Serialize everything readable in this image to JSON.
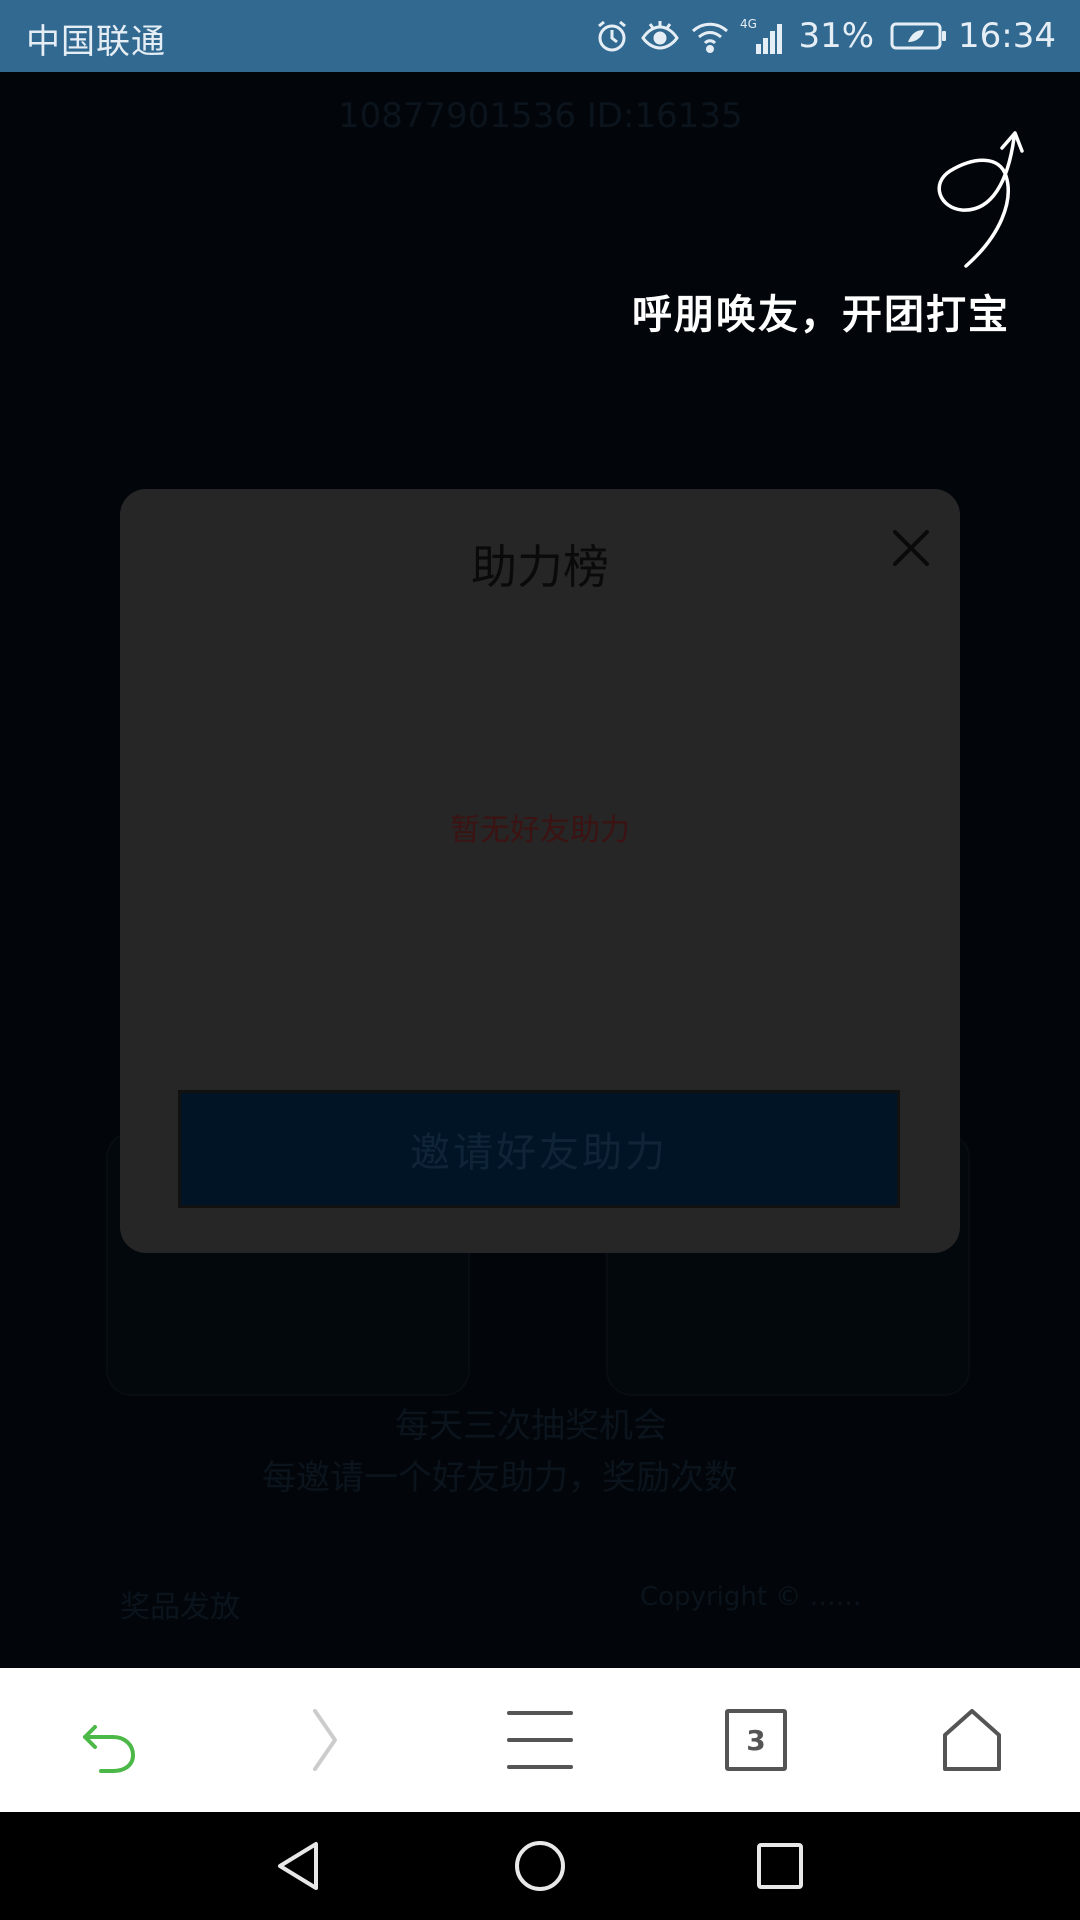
{
  "status_bar": {
    "carrier": "中国联通",
    "network": "4G",
    "battery": "31%",
    "time": "16:34"
  },
  "background_page": {
    "header_text": "10877901536 ID:16135",
    "line_1": "每天三次抽奖机会",
    "line_2": "每邀请一个好友助力，奖励次数",
    "footer_left": "奖品发放",
    "footer_right": "Copyright © ……"
  },
  "guide": {
    "hint": "呼朋唤友，开团打宝"
  },
  "modal": {
    "title": "助力榜",
    "empty_text": "暂无好友助力",
    "invite_button": "邀请好友助力"
  },
  "browser_toolbar": {
    "tab_count": "3",
    "icons": [
      "back-icon",
      "forward-icon",
      "menu-icon",
      "tabs-icon",
      "home-icon"
    ],
    "colors": {
      "back": "#4cb848",
      "forward": "#cccccc",
      "default": "#555555"
    }
  },
  "nav_bar": {
    "icons": [
      "nav-back-icon",
      "nav-home-icon",
      "nav-recents-icon"
    ]
  }
}
